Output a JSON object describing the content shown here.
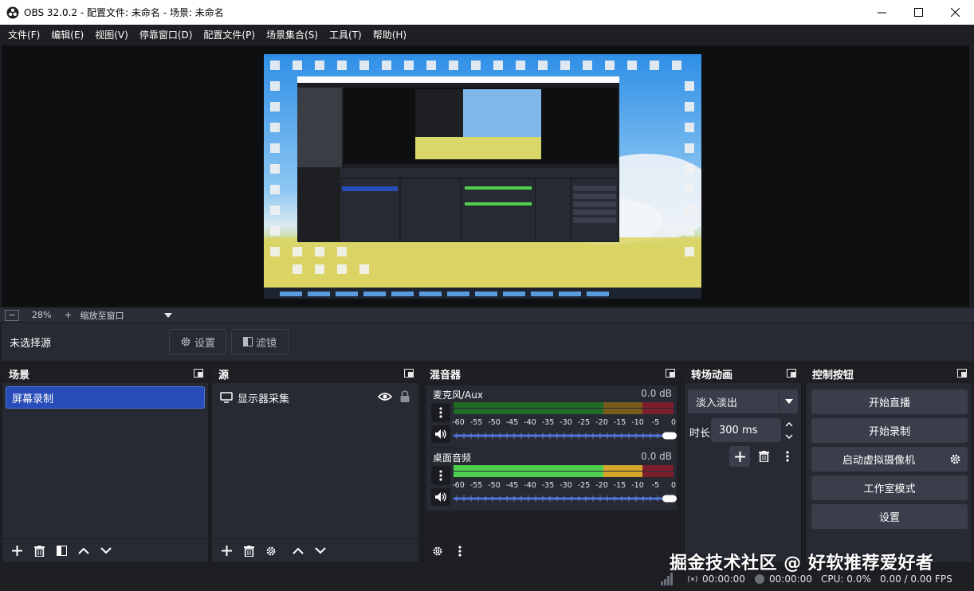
{
  "window": {
    "title": "OBS 32.0.2 - 配置文件: 未命名 - 场景: 未命名"
  },
  "menu": [
    "文件(F)",
    "编辑(E)",
    "视图(V)",
    "停靠窗口(D)",
    "配置文件(P)",
    "场景集合(S)",
    "工具(T)",
    "帮助(H)"
  ],
  "zoom": {
    "minus": "−",
    "value": "28%",
    "plus": "+",
    "mode": "缩放至窗口"
  },
  "context": {
    "no_source": "未选择源",
    "settings": "设置",
    "filters": "滤镜"
  },
  "docks": {
    "scenes": {
      "title": "场景",
      "items": [
        "屏幕录制"
      ]
    },
    "sources": {
      "title": "源",
      "items": [
        "显示器采集"
      ]
    },
    "mixer": {
      "title": "混音器",
      "ticks": [
        "-60",
        "-55",
        "-50",
        "-45",
        "-40",
        "-35",
        "-30",
        "-25",
        "-20",
        "-15",
        "-10",
        "-5",
        "0"
      ],
      "channels": [
        {
          "name": "麦克风/Aux",
          "db": "0.0 dB",
          "level": 0.0
        },
        {
          "name": "桌面音频",
          "db": "0.0 dB",
          "level": 0.86
        }
      ]
    },
    "transitions": {
      "title": "转场动画",
      "selected": "淡入淡出",
      "duration_label": "时长",
      "duration": "300 ms"
    },
    "controls": {
      "title": "控制按钮",
      "buttons": [
        "开始直播",
        "开始录制",
        "启动虚拟摄像机",
        "工作室模式",
        "设置"
      ]
    }
  },
  "status": {
    "stream_time": "00:00:00",
    "record_time": "00:00:00",
    "cpu": "CPU: 0.0%",
    "fps": "0.00 / 0.00 FPS"
  },
  "watermark": "掘金技术社区 @ 好软推荐爱好者",
  "colors": {
    "accent": "#284cb8",
    "meter_green": "#4fce4f",
    "meter_yellow": "#d6a62c",
    "meter_red": "#d6344a"
  }
}
